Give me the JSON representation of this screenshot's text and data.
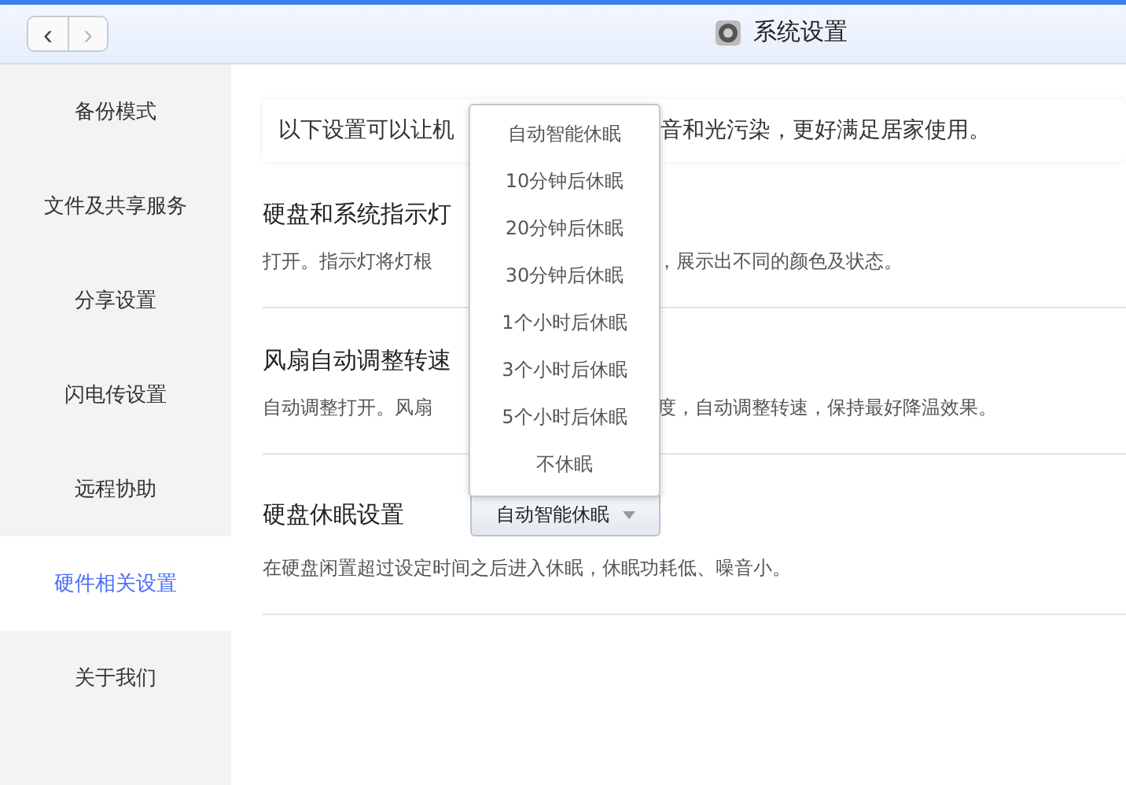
{
  "window": {
    "title": "系统设置"
  },
  "nav": {
    "back": "‹",
    "forward": "›"
  },
  "sidebar": {
    "items": [
      {
        "label": "备份模式",
        "selected": false
      },
      {
        "label": "文件及共享服务",
        "selected": false
      },
      {
        "label": "分享设置",
        "selected": false
      },
      {
        "label": "闪电传设置",
        "selected": false
      },
      {
        "label": "远程协助",
        "selected": false
      },
      {
        "label": "硬件相关设置",
        "selected": true
      },
      {
        "label": "关于我们",
        "selected": false
      }
    ]
  },
  "notice": [
    "以下设置可以让机",
    "音和光污染，更好满足居家使用。"
  ],
  "sections": [
    {
      "title": [
        "硬盘和系统指示灯"
      ],
      "description": [
        "打开。指示灯将灯根",
        "，展示出不同的颜色及状态。"
      ]
    },
    {
      "title": [
        "风扇自动调整转速"
      ],
      "description": [
        "自动调整打开。风扇",
        "度，自动调整转速，保持最好降温效果。"
      ]
    },
    {
      "title": [
        "硬盘休眠设置"
      ],
      "select": {
        "value": "自动智能休眠"
      },
      "description": [
        "在硬盘闲置超过设定时间之后进入休眠，休眠功耗低、噪音小。"
      ]
    }
  ],
  "dropdown": {
    "options": [
      "自动智能休眠",
      "10分钟后休眠",
      "20分钟后休眠",
      "30分钟后休眠",
      "1个小时后休眠",
      "3个小时后休眠",
      "5个小时后休眠",
      "不休眠"
    ]
  }
}
